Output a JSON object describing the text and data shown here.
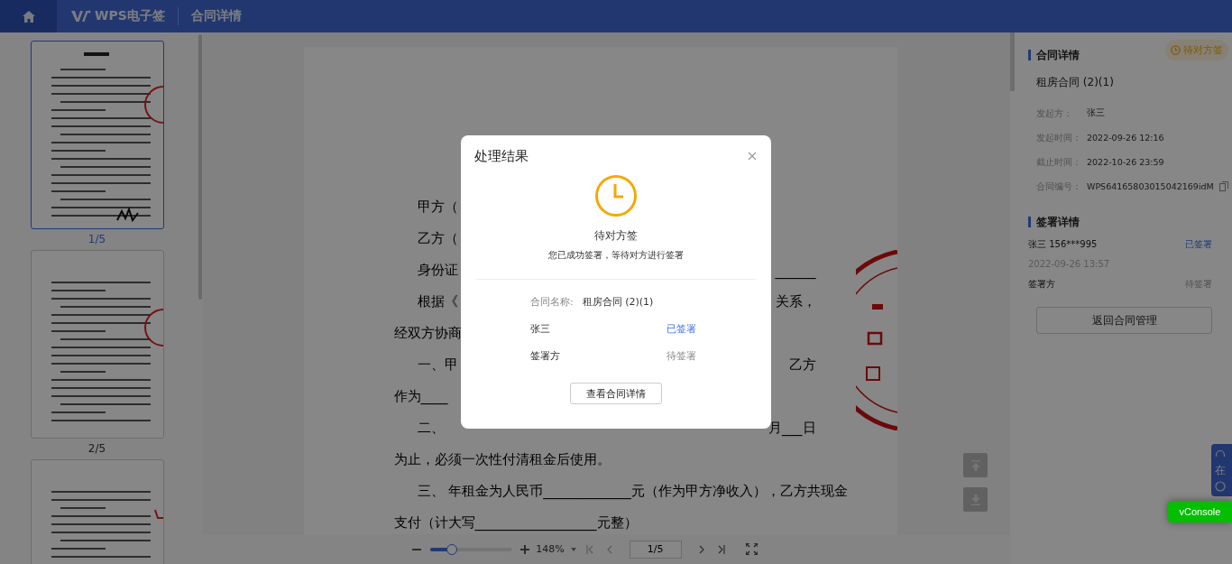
{
  "header": {
    "logo": "WPS电子签",
    "title": "合同详情"
  },
  "thumbnails": [
    {
      "label": "1/5",
      "selected": true
    },
    {
      "label": "2/5",
      "selected": false
    },
    {
      "selected": false
    }
  ],
  "document": {
    "lines": [
      {
        "kind": "paragraph",
        "left": "甲方（"
      },
      {
        "kind": "paragraph",
        "left": "乙方（"
      },
      {
        "kind": "paragraph",
        "left": "身份证",
        "right": "______"
      },
      {
        "kind": "paragraph",
        "left": "根据《",
        "right": "关系，"
      },
      {
        "kind": "plain",
        "left": "经双方协商"
      },
      {
        "kind": "paragraph",
        "left": "一、甲",
        "right": "乙方"
      },
      {
        "kind": "plain",
        "left": "作为____"
      },
      {
        "kind": "paragraph",
        "left": "二、",
        "right": "月___日"
      },
      {
        "kind": "plain",
        "left": "为止，必须一次性付清租金后使用。"
      },
      {
        "kind": "paragraph",
        "left": "三、 年租金为人民币_____________元（作为甲方净收入），乙方共现金"
      },
      {
        "kind": "plain",
        "left": "支付（计大写__________________元整）"
      }
    ]
  },
  "toolbar": {
    "zoom": {
      "level": 0.28,
      "value": "148%"
    },
    "page": "1/5"
  },
  "details": {
    "badge": "待对方签",
    "title": "合同详情",
    "contract_name": "租房合同 (2)(1)",
    "fields": [
      {
        "label": "发起方：",
        "value": "张三"
      },
      {
        "label": "发起时间：",
        "value": "2022-09-26 12:16"
      },
      {
        "label": "截止时间：",
        "value": "2022-10-26 23:59"
      },
      {
        "label": "合同编号：",
        "value": "WPS64165803015042169idM"
      }
    ],
    "signing_title": "签署详情",
    "signers": [
      {
        "name": "张三 156***995",
        "time": "2022-09-26 13:57",
        "status": "已签署",
        "signed": true
      },
      {
        "name": "签署方",
        "status": "待签署",
        "signed": false
      }
    ],
    "back_button": "返回合同管理"
  },
  "float_tab": {
    "label": "在"
  },
  "vconsole": "vConsole",
  "dialog": {
    "title": "处理结果",
    "status": "待对方签",
    "message": "您已成功签署，等待对方进行签署",
    "name_label": "合同名称:",
    "name_value": "租房合同 (2)(1)",
    "signers": [
      {
        "name": "张三",
        "status": "已签署",
        "signed": true
      },
      {
        "name": "签署方",
        "status": "待签署",
        "signed": false
      }
    ],
    "button": "查看合同详情"
  }
}
